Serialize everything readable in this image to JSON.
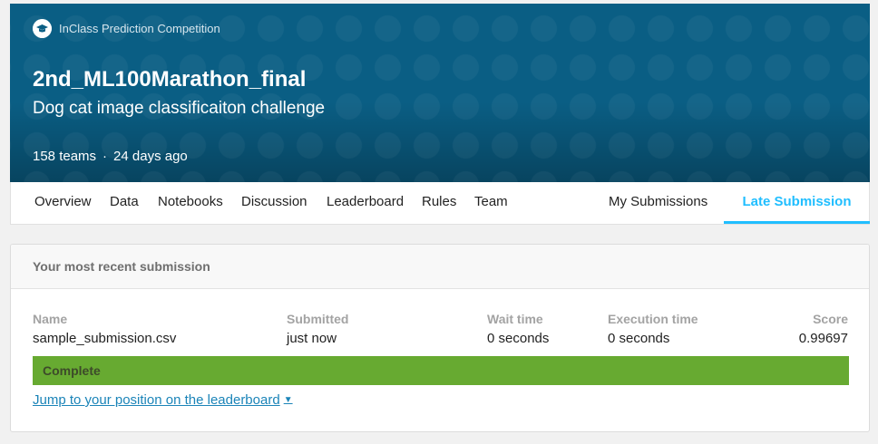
{
  "competition": {
    "kind": "InClass Prediction Competition",
    "title": "2nd_ML100Marathon_final",
    "subtitle": "Dog cat image classificaiton challenge",
    "teams": "158 teams",
    "separator": "·",
    "age": "24 days ago"
  },
  "tabs": {
    "overview": "Overview",
    "data": "Data",
    "notebooks": "Notebooks",
    "discussion": "Discussion",
    "leaderboard": "Leaderboard",
    "rules": "Rules",
    "team": "Team",
    "my_submissions": "My Submissions",
    "late_submission": "Late Submission",
    "active": "Late Submission"
  },
  "submission": {
    "header": "Your most recent submission",
    "columns": {
      "name": {
        "label": "Name",
        "value": "sample_submission.csv"
      },
      "submitted": {
        "label": "Submitted",
        "value": "just now"
      },
      "wait": {
        "label": "Wait time",
        "value": "0 seconds"
      },
      "execution": {
        "label": "Execution time",
        "value": "0 seconds"
      },
      "score": {
        "label": "Score",
        "value": "0.99697"
      }
    },
    "status": "Complete",
    "jump_link": "Jump to your position on the leaderboard",
    "caret": "▼"
  },
  "colors": {
    "hero": "#0a5e84",
    "accent": "#20beff",
    "complete": "#67aa31",
    "link": "#1b84b8"
  },
  "icons": {
    "kind_icon": "graduation-cap-icon",
    "jump_icon": "chevron-down-icon"
  }
}
